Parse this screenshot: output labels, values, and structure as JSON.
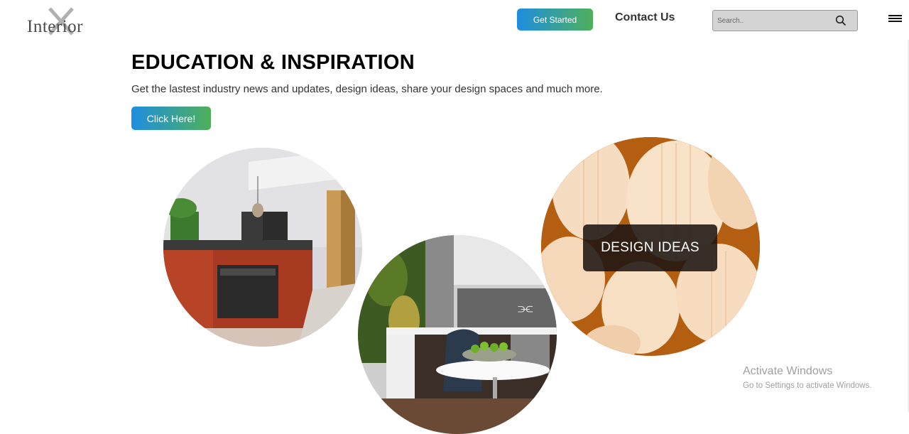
{
  "header": {
    "logo_text": "Interior",
    "get_started_label": "Get Started",
    "contact_label": "Contact Us",
    "search": {
      "placeholder": "Search..",
      "value": ""
    },
    "icons": [
      "logo-x-icon",
      "search-icon",
      "hamburger-menu-icon"
    ]
  },
  "hero": {
    "heading": "EDUCATION & INSPIRATION",
    "subtext": "Get the lastest industry news and updates, design ideas, share your design spaces and much more.",
    "cta_label": "Click Here!"
  },
  "gallery": {
    "images": [
      "kitchen-red-cabinets",
      "kitchen-dining-table",
      "pendant-lamps"
    ],
    "overlay_label": "DESIGN IDEAS"
  },
  "watermark": {
    "title": "Activate Windows",
    "subtitle": "Go to Settings to activate Windows."
  },
  "colors": {
    "gradient_start": "#1e8ee0",
    "gradient_end": "#4fb05a",
    "search_bg": "#d4d4d4",
    "overlay_bg": "#1e1612"
  }
}
